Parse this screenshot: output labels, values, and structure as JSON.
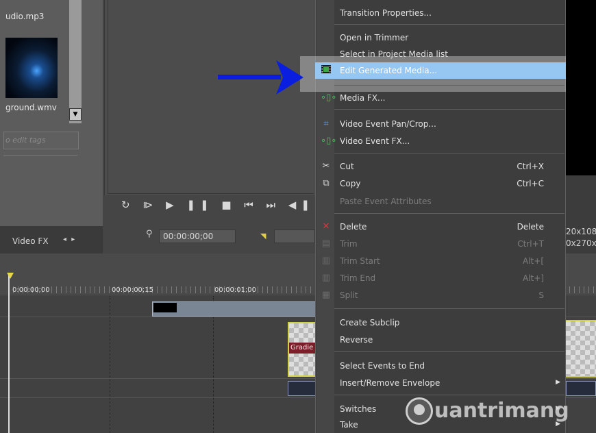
{
  "media": {
    "file1": "udio.mp3",
    "file2": "ground.wmv",
    "tag_placeholder": "o edit tags"
  },
  "tabs": {
    "video_fx": "Video FX",
    "arrows": "◂ ▸"
  },
  "preview": {
    "transport_icons": [
      "loop-icon",
      "play-from-start-icon",
      "play-icon",
      "pause-icon",
      "stop-icon",
      "prev-frame-icon",
      "next-frame-icon",
      "rewind-icon",
      "fast-forward-icon"
    ],
    "transport_glyphs": "↻ ⧐ ▶ ❚❚ ■ ⏮ ⏭ ◀❚ ❚▶",
    "time": "00:00:00;00"
  },
  "ruler": {
    "labels": [
      "0:00:00;00",
      "00:00:00;15",
      "00:00:01;00"
    ]
  },
  "right": {
    "res1": "20x108",
    "res2": "0x270x"
  },
  "clip": {
    "gradient_label": "Gradie"
  },
  "menu": {
    "items": [
      {
        "label": "Transition Properties...",
        "shortcut": "",
        "disabled": false,
        "icon": ""
      },
      {
        "label": "Open in Trimmer",
        "shortcut": "",
        "disabled": false,
        "icon": ""
      },
      {
        "label": "Select in Project Media list",
        "shortcut": "",
        "disabled": false,
        "icon": ""
      },
      {
        "label": "Edit Generated Media...",
        "shortcut": "",
        "disabled": false,
        "icon": "film-icon",
        "highlighted": true
      },
      {
        "label": "Media FX...",
        "shortcut": "",
        "disabled": false,
        "icon": "fx-plugin-icon"
      },
      {
        "label": "Video Event Pan/Crop...",
        "shortcut": "",
        "disabled": false,
        "icon": "crop-icon"
      },
      {
        "label": "Video Event FX...",
        "shortcut": "",
        "disabled": false,
        "icon": "fx-plugin-icon"
      },
      {
        "label": "Cut",
        "shortcut": "Ctrl+X",
        "disabled": false,
        "icon": "scissors-icon"
      },
      {
        "label": "Copy",
        "shortcut": "Ctrl+C",
        "disabled": false,
        "icon": "copy-icon"
      },
      {
        "label": "Paste Event Attributes",
        "shortcut": "",
        "disabled": true,
        "icon": ""
      },
      {
        "label": "Delete",
        "shortcut": "Delete",
        "disabled": false,
        "icon": "delete-x-icon"
      },
      {
        "label": "Trim",
        "shortcut": "Ctrl+T",
        "disabled": true,
        "icon": "trim-icon"
      },
      {
        "label": "Trim Start",
        "shortcut": "Alt+[",
        "disabled": true,
        "icon": "trim-start-icon"
      },
      {
        "label": "Trim End",
        "shortcut": "Alt+]",
        "disabled": true,
        "icon": "trim-end-icon"
      },
      {
        "label": "Split",
        "shortcut": "S",
        "disabled": true,
        "icon": "split-icon"
      },
      {
        "label": "Create Subclip",
        "shortcut": "",
        "disabled": false,
        "icon": ""
      },
      {
        "label": "Reverse",
        "shortcut": "",
        "disabled": false,
        "icon": ""
      },
      {
        "label": "Select Events to End",
        "shortcut": "",
        "disabled": false,
        "icon": ""
      },
      {
        "label": "Insert/Remove Envelope",
        "shortcut": "",
        "disabled": false,
        "icon": "",
        "submenu": true
      },
      {
        "label": "Switches",
        "shortcut": "",
        "disabled": false,
        "icon": "",
        "submenu": true
      },
      {
        "label": "Take",
        "shortcut": "",
        "disabled": false,
        "icon": "",
        "submenu": true
      }
    ]
  },
  "watermark": {
    "text": "uantrimang"
  },
  "colors": {
    "highlight": "#96c7f3",
    "arrow": "#0a1ee0",
    "clip_border": "#d2d24a"
  }
}
